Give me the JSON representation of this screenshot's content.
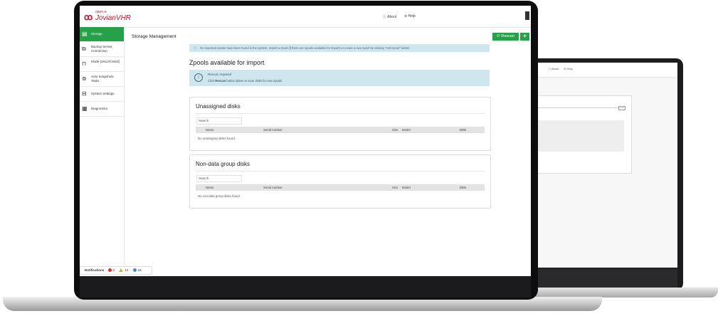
{
  "header": {
    "logo_top": "open-e",
    "logo_main": "JovianVHR",
    "about_label": "About",
    "help_label": "Help"
  },
  "sidebar": {
    "items": [
      {
        "label": "Storage",
        "icon": "storage-icon",
        "active": true
      },
      {
        "label": "Backup Server Connection",
        "icon": "network-icon"
      },
      {
        "label": "Mode (UNLOCKED)",
        "icon": "lock-open-icon"
      },
      {
        "label": "Auto Snapshots Tasks",
        "icon": "snapshot-icon"
      },
      {
        "label": "System Settings",
        "icon": "settings-icon"
      },
      {
        "label": "Diagnostics",
        "icon": "diagnostics-icon"
      }
    ]
  },
  "main": {
    "page_title": "Storage Management",
    "rescan_label": "Rescan",
    "add_label": "+",
    "info_message": "No imported zpools have been found in the system. Import a zpool (if there are zpools available for import) or create a new zpool by clicking \"Add zpool\" button.",
    "zpools_heading": "Zpools available for import",
    "rescan_notice": {
      "title": "Rescan required",
      "body_prefix": "Click",
      "body_bold": "Rescan",
      "body_suffix": "button above to scan disks for new zpools"
    },
    "unassigned": {
      "title": "Unassigned disks",
      "search_placeholder": "Search",
      "columns": [
        "Name",
        "Serial number",
        "Size",
        "Model",
        "Blink"
      ],
      "empty_message": "No unassigned disks found."
    },
    "nondata": {
      "title": "Non-data group disks",
      "search_placeholder": "Search",
      "columns": [
        "Name",
        "Serial number",
        "Size",
        "Model",
        "Blink"
      ],
      "empty_message": "No non-data group disks found."
    }
  },
  "notifications": {
    "label": "Notifications",
    "error_count": "0",
    "warning_count": "12",
    "info_count": "16",
    "error_color": "#d9342b",
    "warning_color": "#f0a030",
    "info_color": "#3a8fd0"
  },
  "back_header": {
    "about_label": "About",
    "help_label": "Help"
  },
  "colors": {
    "accent": "#27a04a",
    "info_bg": "#cfe6ee",
    "brand": "#c8102e"
  }
}
